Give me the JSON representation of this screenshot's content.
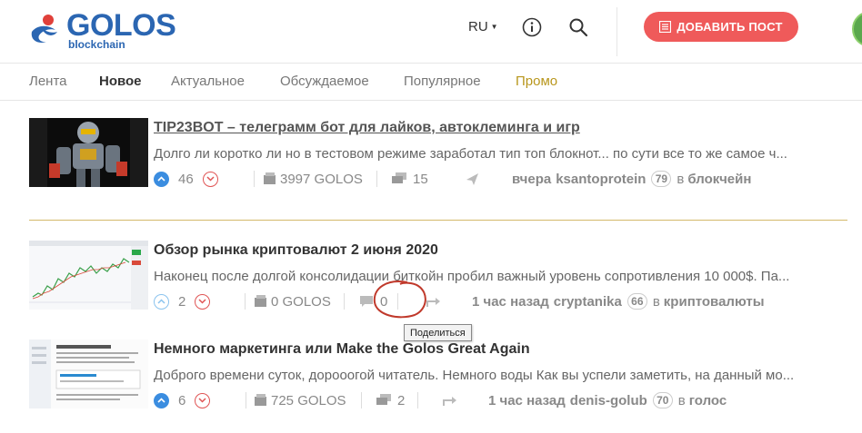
{
  "header": {
    "logo_title": "GOLOS",
    "logo_sub": "blockchain",
    "lang": "RU",
    "add_post_label": "ДОБАВИТЬ ПОСТ"
  },
  "tabs": [
    {
      "label": "Лента"
    },
    {
      "label": "Новое"
    },
    {
      "label": "Актуальное"
    },
    {
      "label": "Обсуждаемое"
    },
    {
      "label": "Популярное"
    },
    {
      "label": "Промо"
    }
  ],
  "posts": [
    {
      "title": "TIP23BOT – телеграмм бот для лайков, автоклеминга и игр",
      "desc": "Долго ли коротко ли но в тестовом режиме заработал тип топ блокнот... по сути все то же самое ч...",
      "votes": "46",
      "payout": "3997 GOLOS",
      "comments": "15",
      "time": "вчера",
      "author": "ksantoprotein",
      "reputation": "79",
      "in_label": "в",
      "category": "блокчейн"
    },
    {
      "title": "Обзор рынка криптовалют 2 июня 2020",
      "desc": "Наконец после долгой консолидации биткойн пробил важный уровень сопротивления 10 000$. Па...",
      "votes": "2",
      "payout": "0 GOLOS",
      "comments": "0",
      "time": "1 час назад",
      "author": "cryptanika",
      "reputation": "66",
      "in_label": "в",
      "category": "криптовалюты"
    },
    {
      "title": "Немного маркетинга или Make the Golos Great Again",
      "desc": "Доброго времени суток, дорооогой читатель. Немного воды Как вы успели заметить, на данный мо...",
      "votes": "6",
      "payout": "725 GOLOS",
      "comments": "2",
      "time": "1 час назад",
      "author": "denis-golub",
      "reputation": "70",
      "in_label": "в",
      "category": "голос"
    }
  ],
  "tooltip": "Поделиться",
  "colors": {
    "brand_blue": "#2b66b2",
    "accent_red": "#ef5a5a",
    "promo_gold": "#b8961c",
    "vote_blue": "#3b8de0"
  }
}
